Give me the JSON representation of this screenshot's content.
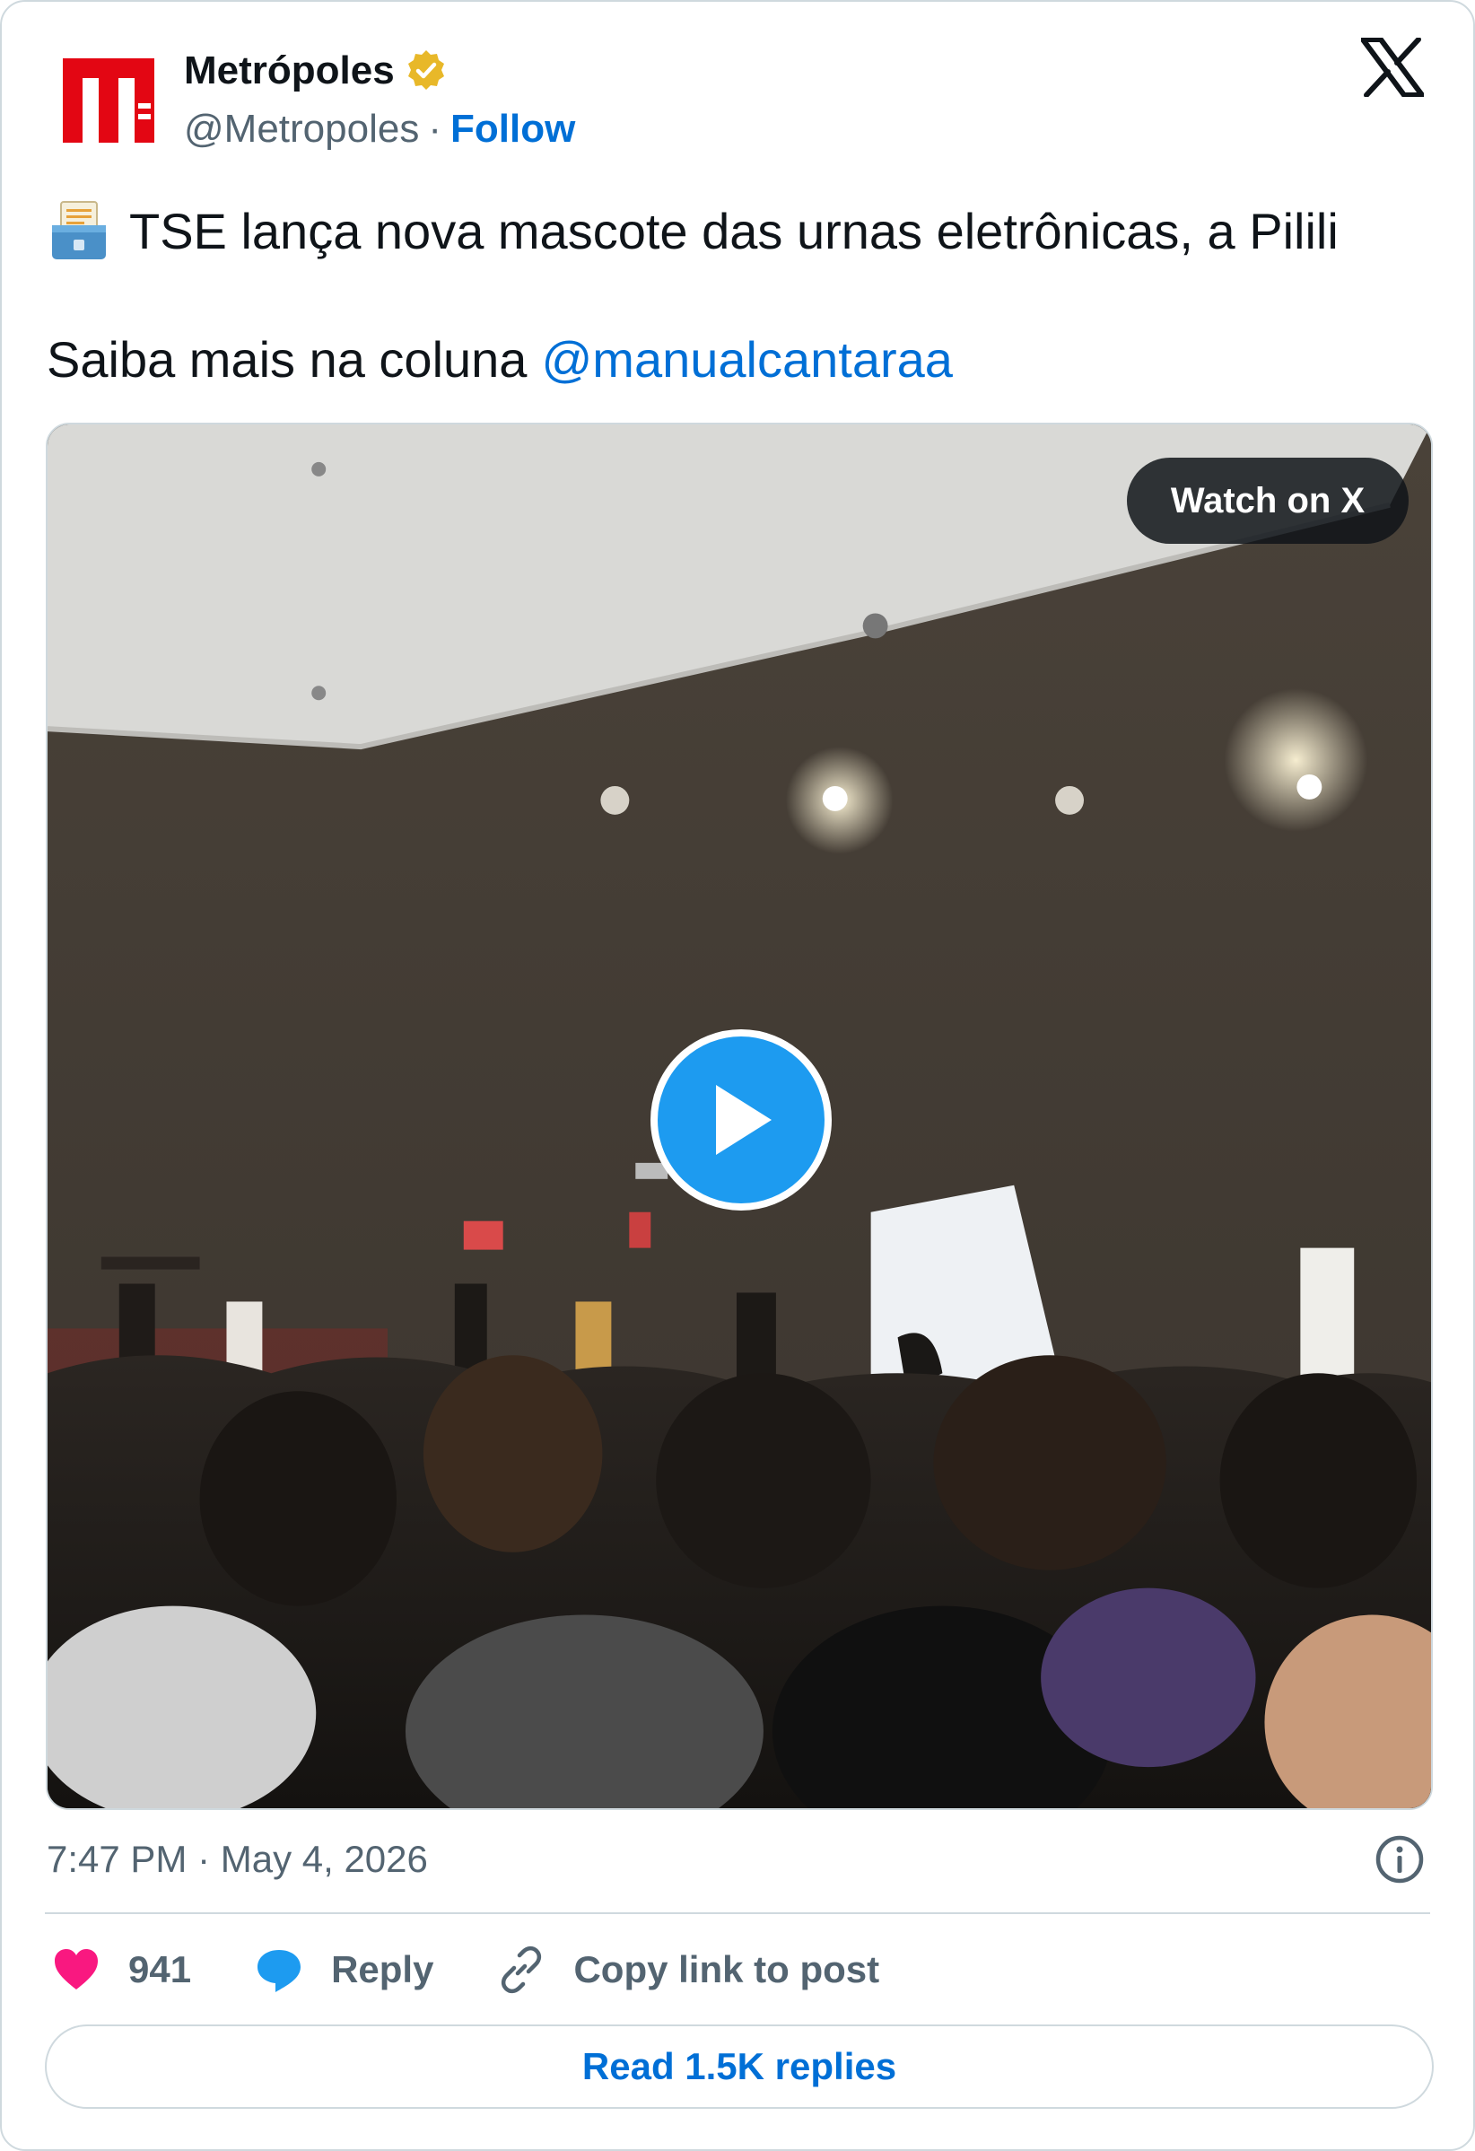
{
  "author": {
    "name": "Metrópoles",
    "handle": "@Metropoles",
    "separator": "·",
    "follow_label": "Follow",
    "verified_badge": "gold-verified-badge",
    "brand_color": "#e30613"
  },
  "tweet": {
    "emoji": "ballot-box-emoji",
    "line1": "TSE lança nova mascote das urnas eletrônicas, a Pilili",
    "line2_prefix": "Saiba mais na coluna",
    "mention": "@manualcantaraa"
  },
  "media": {
    "watch_label": "Watch on X",
    "play_icon": "play-icon",
    "accent": "#1d9bf0"
  },
  "meta": {
    "timestamp": "7:47 PM · May 4, 2026"
  },
  "actions": {
    "likes": "941",
    "reply_label": "Reply",
    "copy_label": "Copy link to post"
  },
  "read_replies_label": "Read 1.5K replies",
  "colors": {
    "link": "#006fd6",
    "secondary_text": "#536471",
    "border": "#cfd9de",
    "like": "#f91880"
  }
}
